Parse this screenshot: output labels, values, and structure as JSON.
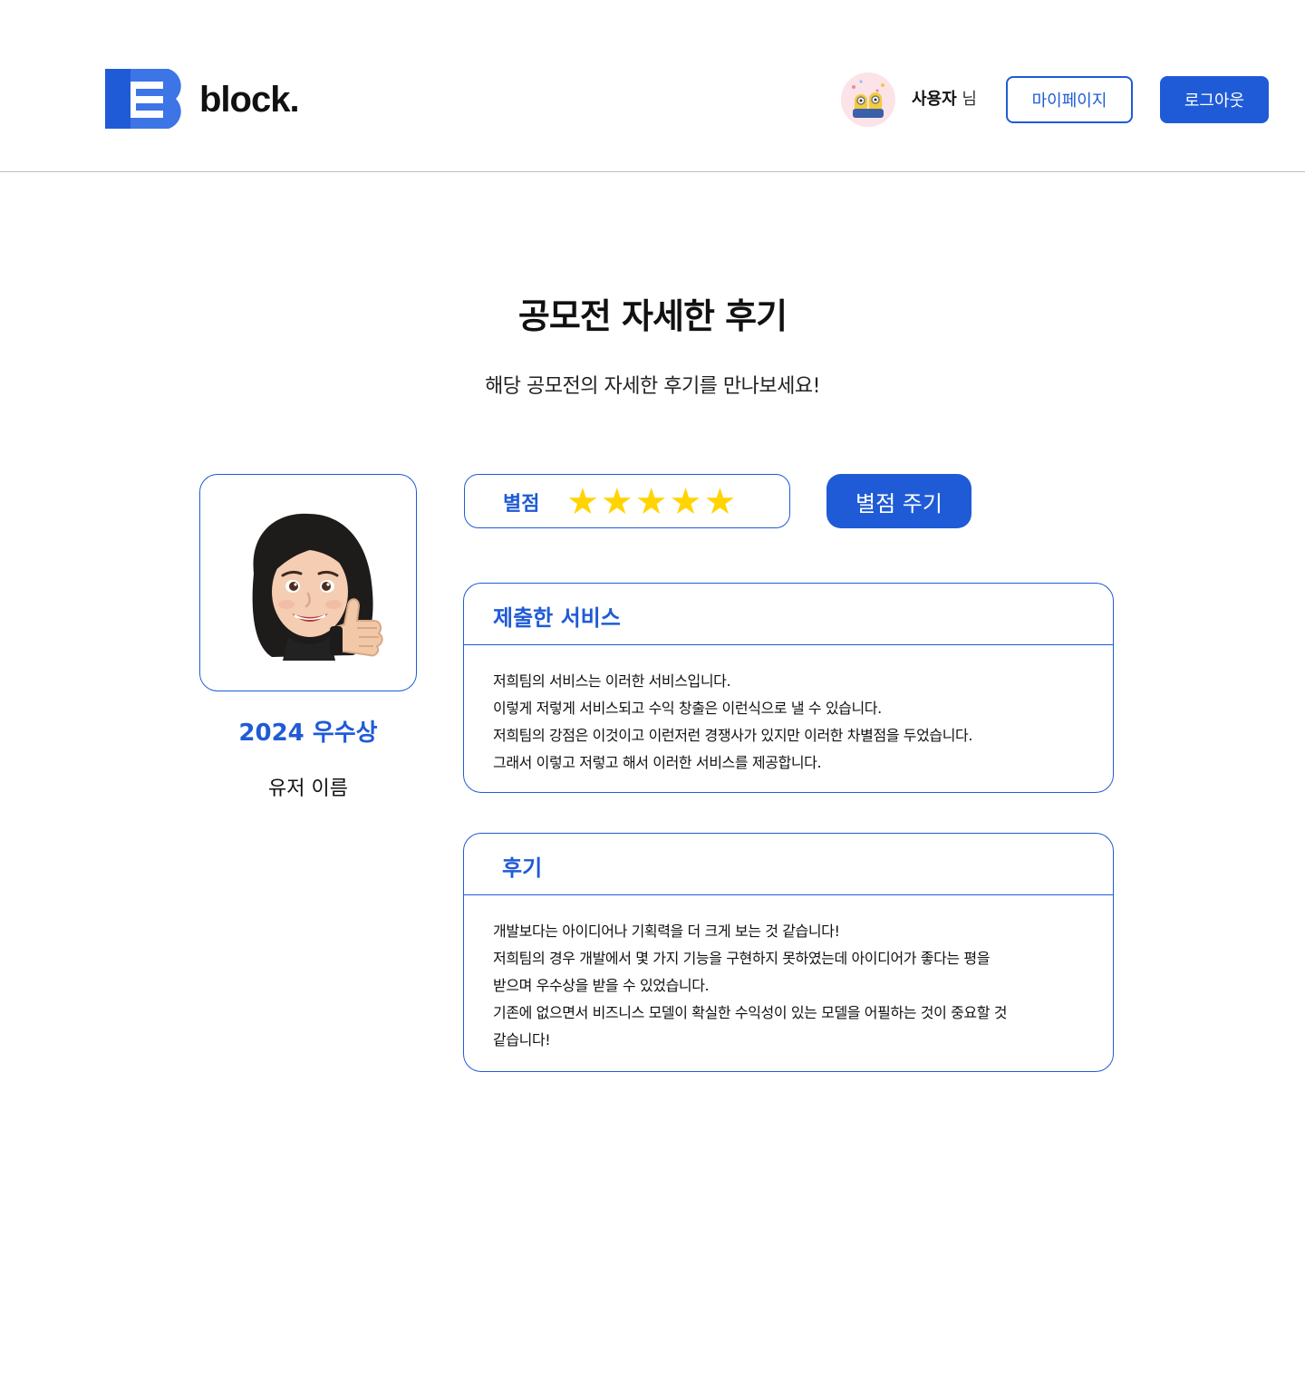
{
  "header": {
    "logo_text": "block.",
    "user_name": "사용자",
    "user_suffix": "님",
    "mypage_label": "마이페이지",
    "logout_label": "로그아웃"
  },
  "main": {
    "title": "공모전 자세한 후기",
    "subtitle": "해당 공모전의 자세한 후기를 만나보세요!"
  },
  "profile": {
    "award": "2024 우수상",
    "user_name": "유저 이름"
  },
  "rating": {
    "label": "별점",
    "stars": [
      "★",
      "★",
      "★",
      "★",
      "★"
    ],
    "value": 5,
    "max": 5,
    "button_label": "별점 주기"
  },
  "service": {
    "heading": "제출한 서비스",
    "lines": [
      "저희팀의 서비스는 이러한 서비스입니다.",
      "이렇게 저렇게 서비스되고 수익 창출은 이런식으로 낼 수 있습니다.",
      "저희팀의 강점은 이것이고 이런저런 경쟁사가 있지만 이러한 차별점을 두었습니다.",
      "그래서 이렇고 저렇고 해서 이러한 서비스를 제공합니다."
    ]
  },
  "review": {
    "heading": "후기",
    "lines": [
      "개발보다는 아이디어나 기획력을 더 크게 보는 것 같습니다!",
      "저희팀의 경우 개발에서 몇 가지 기능을 구현하지 못하였는데 아이디어가 좋다는 평을",
      "받으며 우수상을 받을 수 있었습니다.",
      "기존에 없으면서 비즈니스 모델이 확실한 수익성이 있는 모델을 어필하는 것이 중요할 것",
      "같습니다!"
    ]
  },
  "colors": {
    "accent": "#1f5bd6",
    "star": "#ffd400",
    "divider": "#bdbdbd",
    "avatar_bg": "#fbe3e8"
  },
  "icons": {
    "logo": "block-logo-icon",
    "avatar": "minion-avatar-icon",
    "profile": "memoji-thumbs-up-icon",
    "star": "star-icon"
  }
}
